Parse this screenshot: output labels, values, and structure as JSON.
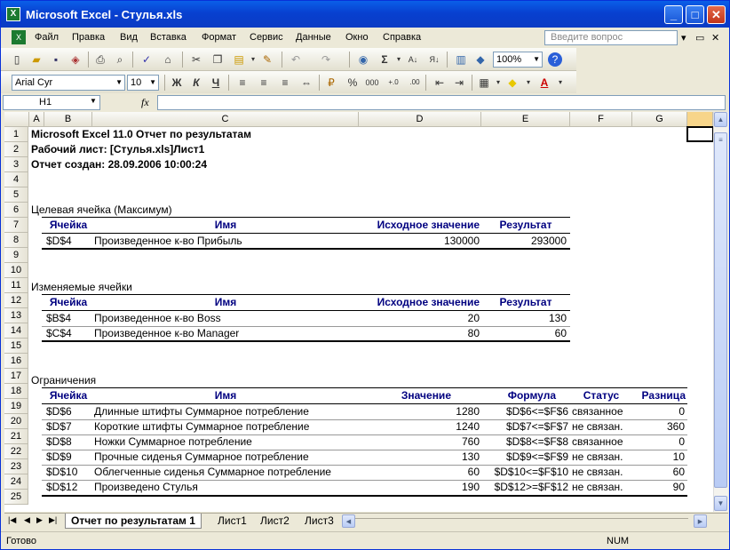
{
  "window": {
    "title": "Microsoft Excel - Стулья.xls",
    "icon": "excel-icon"
  },
  "menu": [
    "Файл",
    "Правка",
    "Вид",
    "Вставка",
    "Формат",
    "Сервис",
    "Данные",
    "Окно",
    "Справка"
  ],
  "help_placeholder": "Введите вопрос",
  "toolbar": {
    "zoom": "100%",
    "font": "Arial Cyr",
    "size": "10",
    "bold": "Ж",
    "italic": "К",
    "underline": "Ч",
    "percent": "%",
    "thousands": "000"
  },
  "formula_bar": {
    "name_box": "H1",
    "fx": "fx",
    "value": ""
  },
  "columns": [
    "A",
    "B",
    "C",
    "D",
    "E",
    "F",
    "G"
  ],
  "rows": [
    "1",
    "2",
    "3",
    "4",
    "5",
    "6",
    "7",
    "8",
    "9",
    "10",
    "11",
    "12",
    "13",
    "14",
    "15",
    "16",
    "17",
    "18",
    "19",
    "20",
    "21",
    "22",
    "23",
    "24",
    "25"
  ],
  "report": {
    "line1": "Microsoft Excel 11.0 Отчет по результатам",
    "line2": "Рабочий лист: [Стулья.xls]Лист1",
    "line3": "Отчет создан: 28.09.2006 10:00:24"
  },
  "target": {
    "title": "Целевая ячейка (Максимум)",
    "headers": [
      "Ячейка",
      "Имя",
      "Исходное значение",
      "Результат"
    ],
    "rows": [
      [
        "$D$4",
        "Произведенное к-во Прибыль",
        "130000",
        "293000"
      ]
    ]
  },
  "changing": {
    "title": "Изменяемые ячейки",
    "headers": [
      "Ячейка",
      "Имя",
      "Исходное значение",
      "Результат"
    ],
    "rows": [
      [
        "$B$4",
        "Произведенное к-во Boss",
        "20",
        "130"
      ],
      [
        "$C$4",
        "Произведенное к-во Manager",
        "80",
        "60"
      ]
    ]
  },
  "constraints": {
    "title": "Ограничения",
    "headers": [
      "Ячейка",
      "Имя",
      "Значение",
      "Формула",
      "Статус",
      "Разница"
    ],
    "rows": [
      [
        "$D$6",
        "Длинные штифты Суммарное потребление",
        "1280",
        "$D$6<=$F$6",
        "связанное",
        "0"
      ],
      [
        "$D$7",
        "Короткие штифты Суммарное потребление",
        "1240",
        "$D$7<=$F$7",
        "не связан.",
        "360"
      ],
      [
        "$D$8",
        "Ножки Суммарное потребление",
        "760",
        "$D$8<=$F$8",
        "связанное",
        "0"
      ],
      [
        "$D$9",
        "Прочные сиденья Суммарное потребление",
        "130",
        "$D$9<=$F$9",
        "не связан.",
        "10"
      ],
      [
        "$D$10",
        "Облегченные сиденья Суммарное потребление",
        "60",
        "$D$10<=$F$10",
        "не связан.",
        "60"
      ],
      [
        "$D$12",
        "Произведено Стулья",
        "190",
        "$D$12>=$F$12",
        "не связан.",
        "90"
      ]
    ]
  },
  "tabs": [
    "Отчет по результатам 1",
    "Лист1",
    "Лист2",
    "Лист3"
  ],
  "status": {
    "left": "Готово",
    "num": "NUM"
  }
}
